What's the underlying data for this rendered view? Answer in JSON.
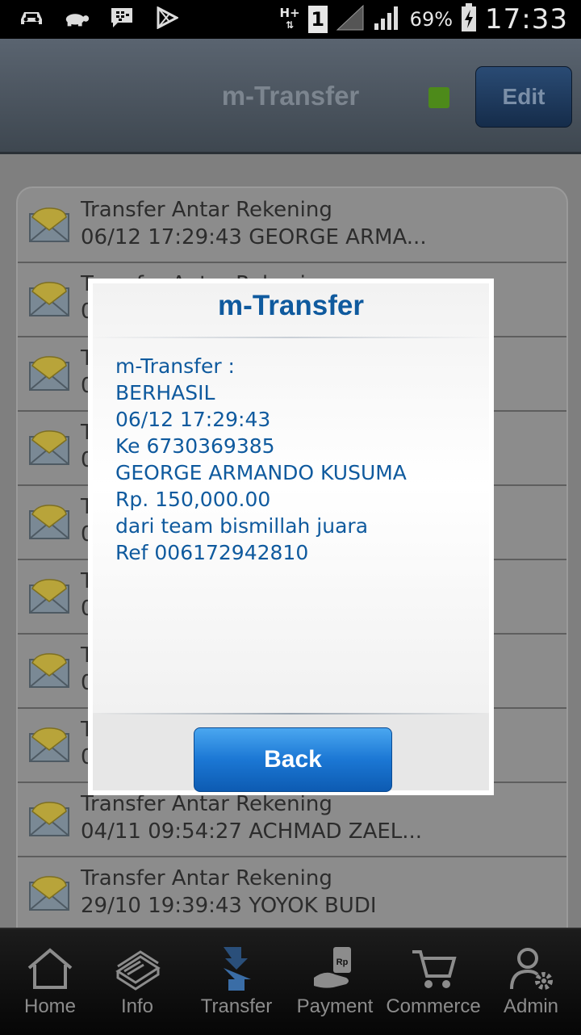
{
  "status_bar": {
    "network_type": "H+",
    "sim_slot": "1",
    "battery": "69%",
    "time": "17:33"
  },
  "header": {
    "title": "m-Transfer",
    "edit_label": "Edit",
    "status_color": "#4d8a1a"
  },
  "list": {
    "items": [
      {
        "title": "Transfer Antar Rekening",
        "subtitle": "06/12 17:29:43 GEORGE ARMA..."
      },
      {
        "title": "Transfer Antar Rekening",
        "subtitle": "0"
      },
      {
        "title": "T",
        "subtitle": "0"
      },
      {
        "title": "T",
        "subtitle": "0"
      },
      {
        "title": "T",
        "subtitle": "0"
      },
      {
        "title": "T",
        "subtitle": "0"
      },
      {
        "title": "T",
        "subtitle": "0"
      },
      {
        "title": "T",
        "subtitle": "0"
      },
      {
        "title": "Transfer Antar Rekening",
        "subtitle": "04/11 09:54:27 ACHMAD ZAEL..."
      },
      {
        "title": "Transfer Antar Rekening",
        "subtitle": "29/10 19:39:43 YOYOK BUDI"
      }
    ]
  },
  "dialog": {
    "title": "m-Transfer",
    "lines": [
      "m-Transfer :",
      "BERHASIL",
      "06/12 17:29:43",
      "Ke 6730369385",
      "GEORGE ARMANDO KUSUMA",
      "Rp. 150,000.00",
      "dari team bismillah juara",
      "Ref 006172942810"
    ],
    "back_label": "Back"
  },
  "bottom_nav": {
    "items": [
      {
        "label": "Home",
        "icon": "home-icon"
      },
      {
        "label": "Info",
        "icon": "info-book-icon"
      },
      {
        "label": "Transfer",
        "icon": "transfer-icon",
        "active": true
      },
      {
        "label": "Payment",
        "icon": "payment-icon"
      },
      {
        "label": "Commerce",
        "icon": "cart-icon"
      },
      {
        "label": "Admin",
        "icon": "admin-icon"
      }
    ]
  },
  "colors": {
    "accent": "#0f5a9e",
    "button": "#1b77d4",
    "nav_label": "#8c8c8c"
  }
}
